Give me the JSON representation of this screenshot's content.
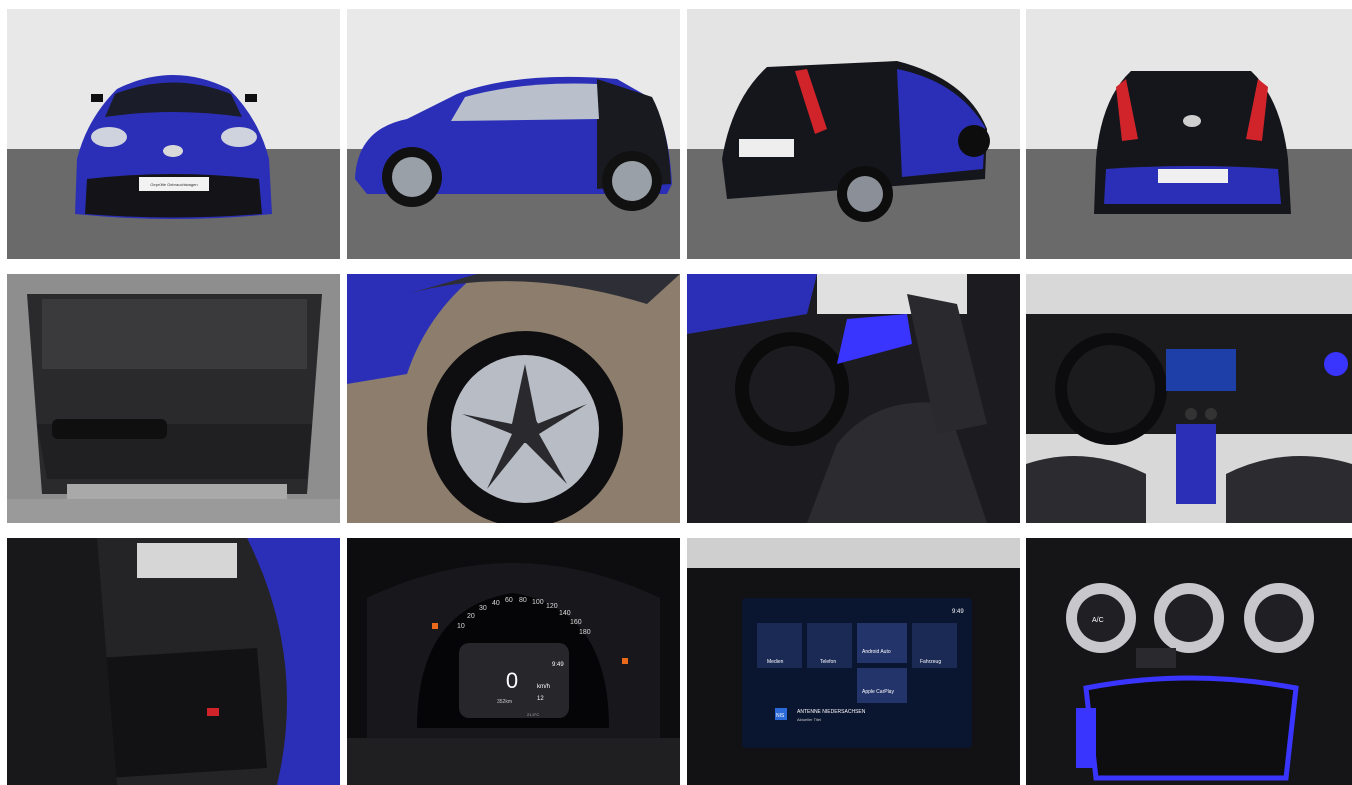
{
  "gallery": {
    "photos": [
      {
        "subject": "car-front-exterior"
      },
      {
        "subject": "car-side-exterior"
      },
      {
        "subject": "car-rear-three-quarter"
      },
      {
        "subject": "car-rear-exterior"
      },
      {
        "subject": "trunk-interior"
      },
      {
        "subject": "alloy-wheel"
      },
      {
        "subject": "front-seats"
      },
      {
        "subject": "dashboard"
      },
      {
        "subject": "rear-seats"
      },
      {
        "subject": "instrument-cluster"
      },
      {
        "subject": "infotainment-screen"
      },
      {
        "subject": "climate-controls"
      }
    ],
    "plate_text": "Geprüfte Gebrauchtwagen",
    "cluster": {
      "speed": "0",
      "speed_unit": "km/h",
      "time": "9:49",
      "range": "352km",
      "odometer": "12",
      "temp": "21.5°C",
      "gauge_ticks": [
        "10",
        "20",
        "30",
        "40",
        "60",
        "80",
        "100",
        "120",
        "140",
        "160",
        "180"
      ]
    },
    "infotainment": {
      "time": "9:49",
      "tiles": [
        "Medien",
        "Telefon",
        "Android Auto",
        "Fahrzeug",
        "Apple CarPlay"
      ],
      "station": "ANTENNE NIEDERSACHSEN",
      "track": "Aktueller Titel",
      "badge": "NIS"
    },
    "climate": {
      "ac_label": "A/C"
    }
  },
  "colors": {
    "car_blue": "#2b2fb8",
    "car_black": "#15161c",
    "studio_wall": "#e6e6e6",
    "studio_floor": "#6d6d6d",
    "ambient_blue": "#3a34ff",
    "tail_red": "#d0242a"
  }
}
